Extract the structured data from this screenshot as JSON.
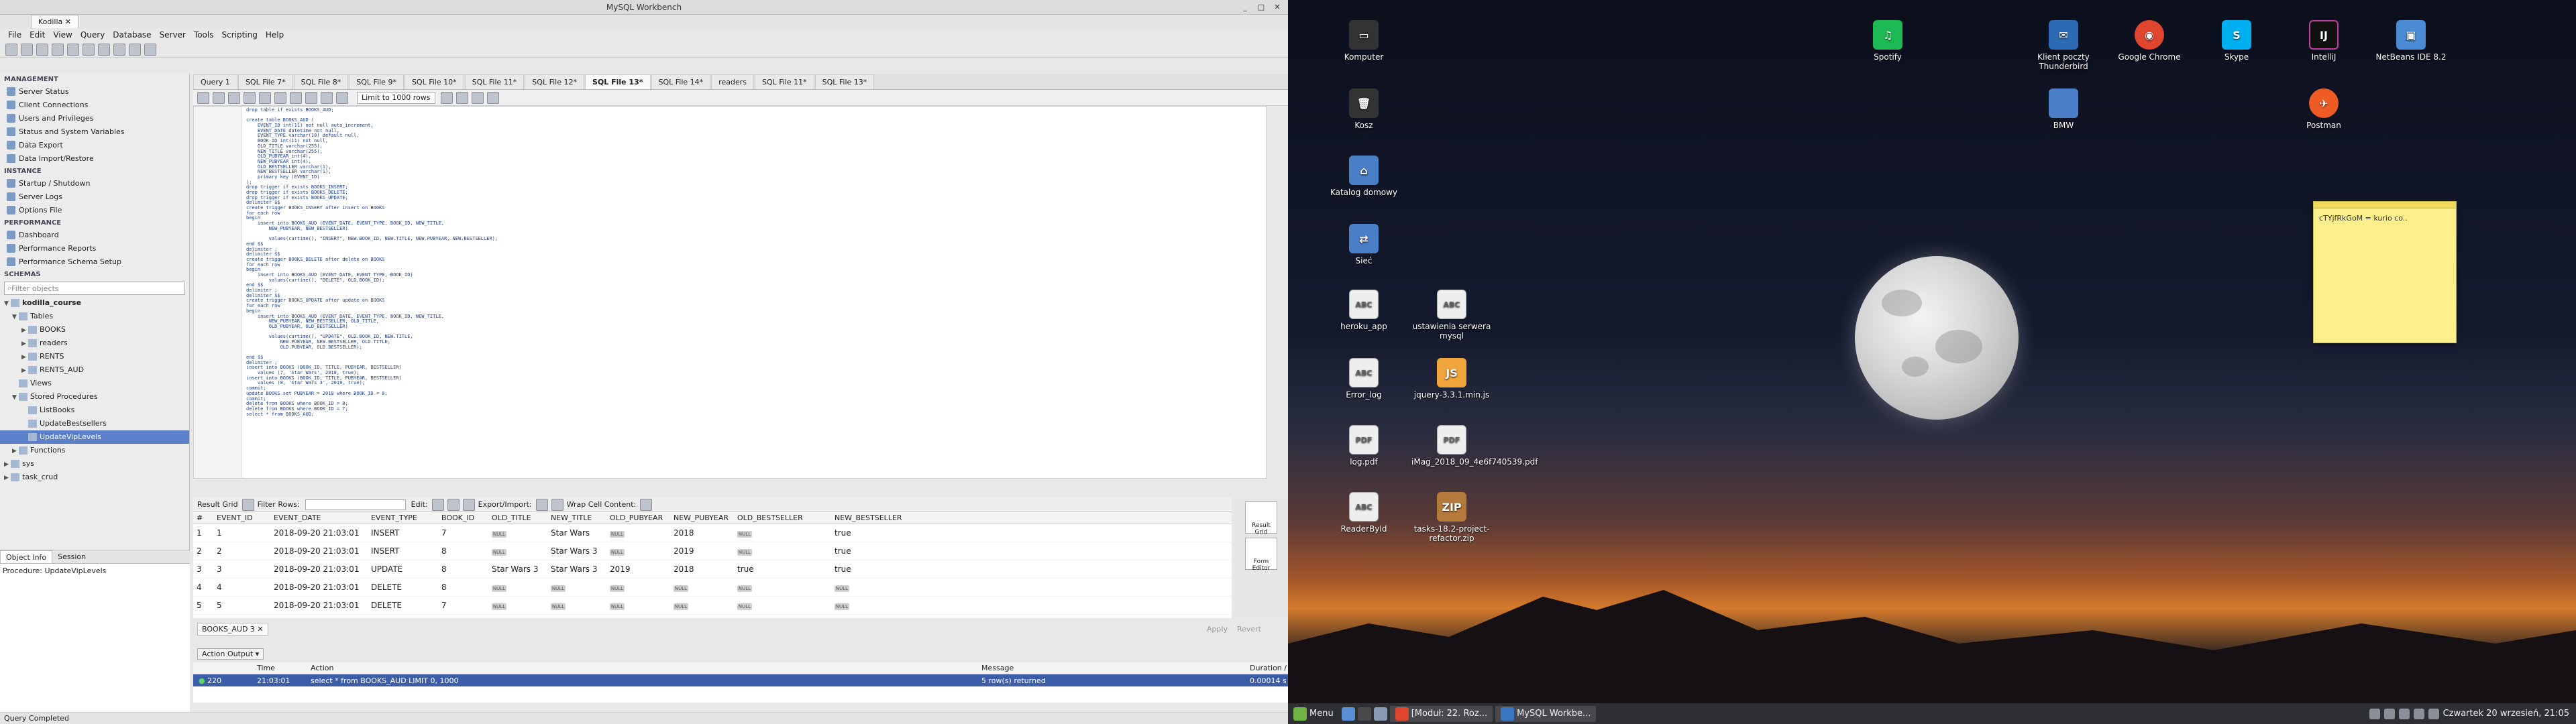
{
  "window": {
    "title": "MySQL Workbench",
    "connection_tab": "Kodilla"
  },
  "menu": [
    "File",
    "Edit",
    "View",
    "Query",
    "Database",
    "Server",
    "Tools",
    "Scripting",
    "Help"
  ],
  "sidebar": {
    "management_header": "MANAGEMENT",
    "management": [
      "Server Status",
      "Client Connections",
      "Users and Privileges",
      "Status and System Variables",
      "Data Export",
      "Data Import/Restore"
    ],
    "instance_header": "INSTANCE",
    "instance": [
      "Startup / Shutdown",
      "Server Logs",
      "Options File"
    ],
    "performance_header": "PERFORMANCE",
    "performance": [
      "Dashboard",
      "Performance Reports",
      "Performance Schema Setup"
    ],
    "schemas_header": "SCHEMAS",
    "filter_placeholder": "Filter objects",
    "tree": {
      "db": "kodilla_course",
      "tables_label": "Tables",
      "tables": [
        "BOOKS",
        "readers",
        "RENTS",
        "RENTS_AUD"
      ],
      "views_label": "Views",
      "procs_label": "Stored Procedures",
      "procs": [
        "ListBooks",
        "UpdateBestsellers",
        "UpdateVipLevels"
      ],
      "functions_label": "Functions",
      "other_dbs": [
        "sys",
        "task_crud"
      ]
    }
  },
  "object_info": {
    "tab1": "Object Info",
    "tab2": "Session",
    "text": "Procedure: UpdateVipLevels"
  },
  "query_tabs": [
    "Query 1",
    "SQL File 7*",
    "SQL File 8*",
    "SQL File 9*",
    "SQL File 10*",
    "SQL File 11*",
    "SQL File 12*",
    "SQL File 13*",
    "SQL File 14*",
    "readers",
    "SQL File 11*",
    "SQL File 13*"
  ],
  "active_tab_index": 7,
  "limit": "Limit to 1000 rows",
  "editor": {
    "lines": [
      "drop table if exists BOOKS_AUD;",
      "",
      "create table BOOKS_AUD (",
      "    EVENT_ID int(11) not null auto_increment,",
      "    EVENT_DATE datetime not null,",
      "    EVENT_TYPE varchar(10) default null,",
      "    BOOK_ID int(11) not null,",
      "    OLD_TITLE varchar(255),",
      "    NEW_TITLE varchar(255),",
      "    OLD_PUBYEAR int(4),",
      "    NEW_PUBYEAR int(4),",
      "    OLD_BESTSELLER varchar(1),",
      "    NEW_BESTSELLER varchar(1),",
      "    primary key (EVENT_ID)",
      ");",
      "drop trigger if exists BOOKS_INSERT;",
      "drop trigger if exists BOOKS_DELETE;",
      "drop trigger if exists BOOKS_UPDATE;",
      "delimiter $$",
      "create trigger BOOKS_INSERT after insert on BOOKS",
      "for each row",
      "begin",
      "    insert into BOOKS_AUD (EVENT_DATE, EVENT_TYPE, BOOK_ID, NEW_TITLE,",
      "        NEW_PUBYEAR, NEW_BESTSELLER)",
      "",
      "        values(curtime(), \"INSERT\", NEW.BOOK_ID, NEW.TITLE, NEW.PUBYEAR, NEW.BESTSELLER);",
      "end $$",
      "delimiter ;",
      "delimiter $$",
      "create trigger BOOKS_DELETE after delete on BOOKS",
      "for each row",
      "begin",
      "    insert into BOOKS_AUD (EVENT_DATE, EVENT_TYPE, BOOK_ID)",
      "        values(curtime(), \"DELETE\", OLD.BOOK_ID);",
      "end $$",
      "delimiter ;",
      "delimiter $$",
      "create trigger BOOKS_UPDATE after update on BOOKS",
      "for each row",
      "begin",
      "    insert into BOOKS_AUD (EVENT_DATE, EVENT_TYPE, BOOK_ID, NEW_TITLE,",
      "        NEW_PUBYEAR, NEW_BESTSELLER, OLD_TITLE,",
      "        OLD_PUBYEAR, OLD_BESTSELLER)",
      "",
      "        values(curtime(), \"UPDATE\", OLD.BOOK_ID, NEW.TITLE,",
      "            NEW.PUBYEAR, NEW.BESTSELLER, OLD.TITLE,",
      "            OLD.PUBYEAR, OLD.BESTSELLER);",
      "",
      "end $$",
      "delimiter ;",
      "insert into BOOKS (BOOK_ID, TITLE, PUBYEAR, BESTSELLER)",
      "    values (7, 'Star Wars', 2018, true);",
      "insert into BOOKS (BOOK_ID, TITLE, PUBYEAR, BESTSELLER)",
      "    values (8, 'Star Wars 3', 2019, true);",
      "commit;",
      "update BOOKS set PUBYEAR = 2018 where BOOK_ID = 8;",
      "commit;",
      "delete from BOOKS where BOOK_ID = 8;",
      "delete from BOOKS where BOOK_ID = 7;",
      "select * from BOOKS_AUD;"
    ]
  },
  "result_toolbar": {
    "result_grid": "Result Grid",
    "filter_rows": "Filter Rows:",
    "edit": "Edit:",
    "export": "Export/Import:",
    "wrap": "Wrap Cell Content:"
  },
  "grid": {
    "columns": [
      "#",
      "EVENT_ID",
      "EVENT_DATE",
      "EVENT_TYPE",
      "BOOK_ID",
      "OLD_TITLE",
      "NEW_TITLE",
      "OLD_PUBYEAR",
      "NEW_PUBYEAR",
      "OLD_BESTSELLER",
      "NEW_BESTSELLER"
    ],
    "rows": [
      [
        "1",
        "1",
        "2018-09-20 21:03:01",
        "INSERT",
        "7",
        "NULL",
        "Star Wars",
        "NULL",
        "2018",
        "NULL",
        "true"
      ],
      [
        "2",
        "2",
        "2018-09-20 21:03:01",
        "INSERT",
        "8",
        "NULL",
        "Star Wars 3",
        "NULL",
        "2019",
        "NULL",
        "true"
      ],
      [
        "3",
        "3",
        "2018-09-20 21:03:01",
        "UPDATE",
        "8",
        "Star Wars 3",
        "Star Wars 3",
        "2019",
        "2018",
        "true",
        "true"
      ],
      [
        "4",
        "4",
        "2018-09-20 21:03:01",
        "DELETE",
        "8",
        "NULL",
        "NULL",
        "NULL",
        "NULL",
        "NULL",
        "NULL"
      ],
      [
        "5",
        "5",
        "2018-09-20 21:03:01",
        "DELETE",
        "7",
        "NULL",
        "NULL",
        "NULL",
        "NULL",
        "NULL",
        "NULL"
      ]
    ]
  },
  "result_side": {
    "grid_btn": "Result Grid",
    "form_btn": "Form Editor"
  },
  "result_tab": "BOOKS_AUD 3",
  "apply": "Apply",
  "revert": "Revert",
  "output": {
    "header": "Action Output",
    "columns": [
      "",
      "Time",
      "Action",
      "Message",
      "Duration / Fetch"
    ],
    "row": [
      "220",
      "21:03:01",
      "select * from BOOKS_AUD LIMIT 0, 1000",
      "5 row(s) returned",
      "0.00014 sec / 0.0..."
    ]
  },
  "status": "Query Completed",
  "desktop_icons": [
    {
      "label": "Komputer"
    },
    {
      "label": "Kosz"
    },
    {
      "label": "Katalog domowy"
    },
    {
      "label": "Sieć"
    },
    {
      "label": "heroku_app"
    },
    {
      "label": "ustawienia serwera mysql"
    },
    {
      "label": "Error_log"
    },
    {
      "label": "jquery-3.3.1.min.js"
    },
    {
      "label": "log.pdf"
    },
    {
      "label": "iMag_2018_09_4e6f740539.pdf"
    },
    {
      "label": "ReaderById"
    },
    {
      "label": "tasks-18.2-project-refactor.zip"
    },
    {
      "label": "Spotify"
    },
    {
      "label": "Klient poczty Thunderbird"
    },
    {
      "label": "Google Chrome"
    },
    {
      "label": "Skype"
    },
    {
      "label": "IntelliJ"
    },
    {
      "label": "NetBeans IDE 8.2"
    },
    {
      "label": "BMW"
    },
    {
      "label": "Postman"
    }
  ],
  "sticky_note": "cTYjfRkGoM = kurio co..",
  "taskbar": {
    "menu": "Menu",
    "win1": "[Moduł: 22. Roz...",
    "win2": "MySQL Workbe...",
    "clock": "Czwartek 20 wrzesień, 21:05"
  }
}
